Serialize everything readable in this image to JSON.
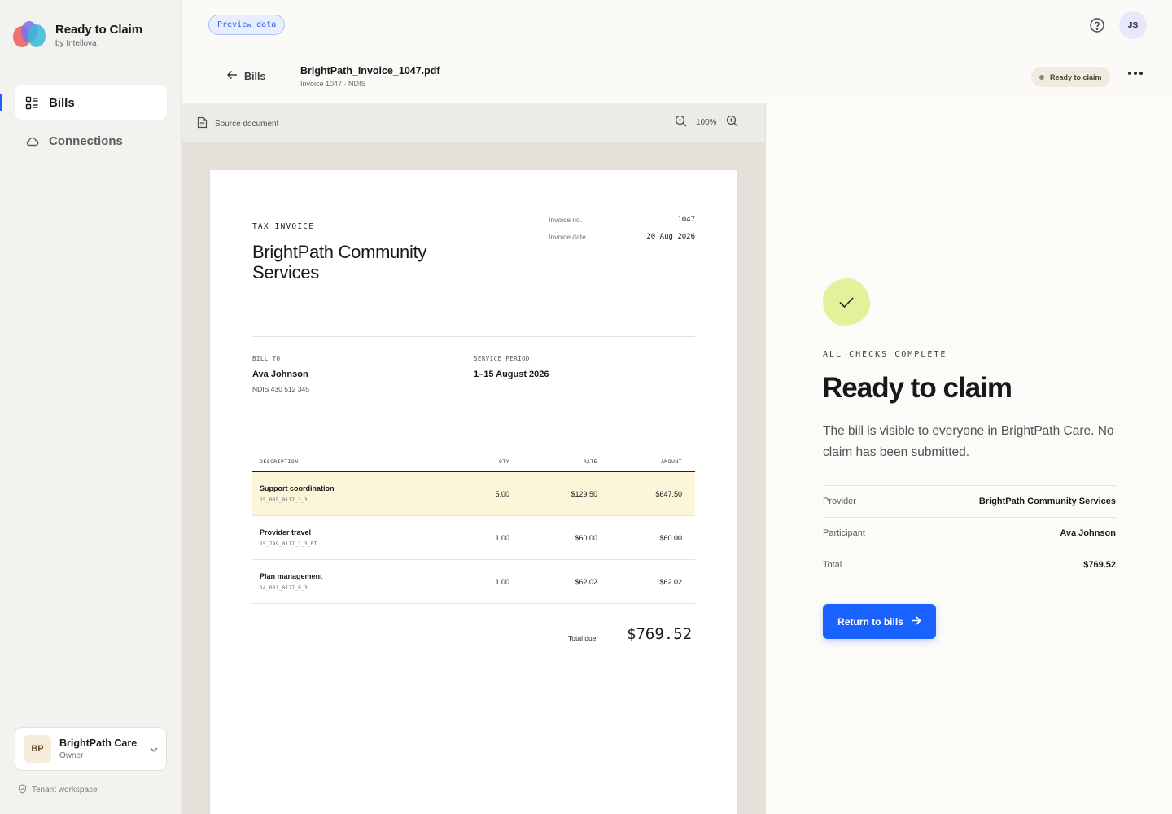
{
  "app": {
    "title": "Ready to Claim",
    "subtitle": "by Intellova"
  },
  "sidebar": {
    "items": [
      {
        "label": "Bills",
        "icon": "list-icon",
        "active": true
      },
      {
        "label": "Connections",
        "icon": "cloud-icon",
        "active": false
      }
    ],
    "org": {
      "initials": "BP",
      "name": "BrightPath Care",
      "role": "Owner"
    },
    "tenant_label": "Tenant workspace"
  },
  "topbar": {
    "preview_label": "Preview data",
    "avatar_initials": "JS"
  },
  "header": {
    "back_label": "Bills",
    "file_name": "BrightPath_Invoice_1047.pdf",
    "file_meta": "Invoice 1047 · NDIS",
    "status": "Ready to claim"
  },
  "viewer": {
    "toolbar_label": "Source document",
    "zoom": "100%"
  },
  "invoice": {
    "kicker": "TAX INVOICE",
    "company": "BrightPath Community Services",
    "meta": [
      {
        "label": "Invoice no.",
        "value": "1047"
      },
      {
        "label": "Invoice date",
        "value": "20 Aug 2026"
      }
    ],
    "bill_to_label": "BILL TO",
    "bill_to_name": "Ava Johnson",
    "bill_to_ndis": "NDIS 430 512 345",
    "service_period_label": "SERVICE PERIOD",
    "service_period": "1–15 August 2026",
    "columns": [
      "DESCRIPTION",
      "QTY",
      "RATE",
      "AMOUNT"
    ],
    "rows": [
      {
        "name": "Support coordination",
        "code": "15_035_0117_1_3",
        "qty": "5.00",
        "rate": "$129.50",
        "amount": "$647.50",
        "highlight": true
      },
      {
        "name": "Provider travel",
        "code": "15_799_0117_1_3_PT",
        "qty": "1.00",
        "rate": "$60.00",
        "amount": "$60.00",
        "highlight": false
      },
      {
        "name": "Plan management",
        "code": "14_031_0127_8_3",
        "qty": "1.00",
        "rate": "$62.02",
        "amount": "$62.02",
        "highlight": false
      }
    ],
    "total_label": "Total due",
    "total_value": "$769.52"
  },
  "panel": {
    "kicker": "ALL CHECKS COMPLETE",
    "title": "Ready to claim",
    "description": "The bill is visible to everyone in BrightPath Care. No claim has been submitted.",
    "details": [
      {
        "label": "Provider",
        "value": "BrightPath Community Services"
      },
      {
        "label": "Participant",
        "value": "Ava Johnson"
      },
      {
        "label": "Total",
        "value": "$769.52"
      }
    ],
    "button_label": "Return to bills"
  },
  "colors": {
    "accent": "#1a62ff",
    "success_blob": "#e3f29a",
    "highlight_row": "#fdf5d9"
  }
}
